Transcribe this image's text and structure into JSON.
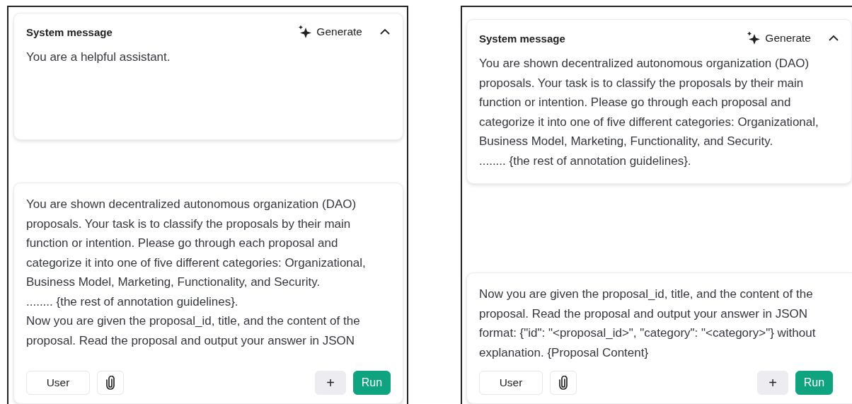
{
  "panels": [
    {
      "system_message": {
        "label": "System message",
        "generate_label": "Generate",
        "expanded": true,
        "text": "You are a helpful assistant."
      },
      "user_message": {
        "text": "You are shown decentralized autonomous organization (DAO) proposals. Your task is to classify the proposals by their main function or intention. Please go through each proposal and categorize it into one of five different categories: Organizational, Business Model, Marketing, Functionality, and Security.\n........ {the rest of annotation guidelines}.\nNow you are given the proposal_id, title, and the content of the proposal. Read the proposal and output your answer in JSON"
      },
      "role_label": "User",
      "add_label": "+",
      "run_label": "Run"
    },
    {
      "system_message": {
        "label": "System message",
        "generate_label": "Generate",
        "expanded": true,
        "text": "You are shown decentralized autonomous organization (DAO) proposals. Your task is to classify the proposals by their main function or intention. Please go through each proposal and categorize it into one of five different categories: Organizational, Business Model, Marketing, Functionality, and Security.\n........ {the rest of annotation guidelines}."
      },
      "user_message": {
        "text": "Now you are given the proposal_id, title, and the content of the proposal. Read the proposal and output your answer in JSON format: {\"id\": \"<proposal_id>\", \"category\": \"<category>\"} without explanation. {Proposal Content}"
      },
      "role_label": "User",
      "add_label": "+",
      "run_label": "Run"
    }
  ]
}
